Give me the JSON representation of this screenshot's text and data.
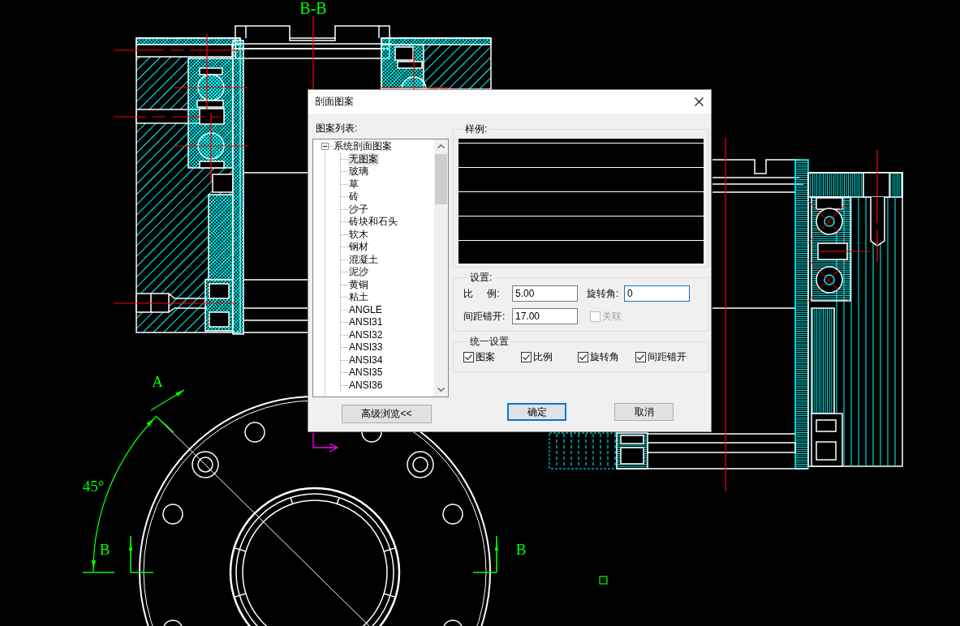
{
  "drawing": {
    "section_title": "B-B",
    "view_label": "A",
    "angle_dimension": "45°",
    "section_marks": [
      "B",
      "B"
    ]
  },
  "dialog": {
    "title": "剖面图案",
    "pattern_list": {
      "label": "图案列表:",
      "tree": [
        {
          "label": "系统剖面图案",
          "expanded": true,
          "selected": false,
          "children": [
            {
              "label": "无图案",
              "selected": true
            },
            {
              "label": "玻璃",
              "selected": false
            },
            {
              "label": "草",
              "selected": false
            },
            {
              "label": "砖",
              "selected": false
            },
            {
              "label": "沙子",
              "selected": false
            },
            {
              "label": "砖块和石头",
              "selected": false
            },
            {
              "label": "软木",
              "selected": false
            },
            {
              "label": "钢材",
              "selected": false
            },
            {
              "label": "混凝土",
              "selected": false
            },
            {
              "label": "泥沙",
              "selected": false
            },
            {
              "label": "黄铜",
              "selected": false
            },
            {
              "label": "粘土",
              "selected": false
            },
            {
              "label": "ANGLE",
              "selected": false
            },
            {
              "label": "ANSI31",
              "selected": false
            },
            {
              "label": "ANSI32",
              "selected": false
            },
            {
              "label": "ANSI33",
              "selected": false
            },
            {
              "label": "ANSI34",
              "selected": false
            },
            {
              "label": "ANSI35",
              "selected": false
            },
            {
              "label": "ANSI36",
              "selected": false
            }
          ]
        }
      ]
    },
    "preview": {
      "label": "样例:"
    },
    "settings": {
      "label": "设置:",
      "scale": {
        "label": "比 例:",
        "value": "5.00",
        "focused": false
      },
      "rotation": {
        "label": "旋转角:",
        "value": "0",
        "focused": true
      },
      "offset": {
        "label": "间距错开:",
        "value": "17.00",
        "focused": false
      },
      "link": {
        "label": "关联",
        "checked": false,
        "disabled": true
      }
    },
    "unified": {
      "label": "统一设置",
      "options": [
        {
          "label": "图案",
          "checked": true
        },
        {
          "label": "比例",
          "checked": true
        },
        {
          "label": "旋转角",
          "checked": true
        },
        {
          "label": "间距错开",
          "checked": true
        }
      ]
    },
    "buttons": {
      "advanced": {
        "label": "高级浏览<<"
      },
      "ok": {
        "label": "确定",
        "default": true
      },
      "cancel": {
        "label": "取消",
        "default": false
      }
    }
  }
}
